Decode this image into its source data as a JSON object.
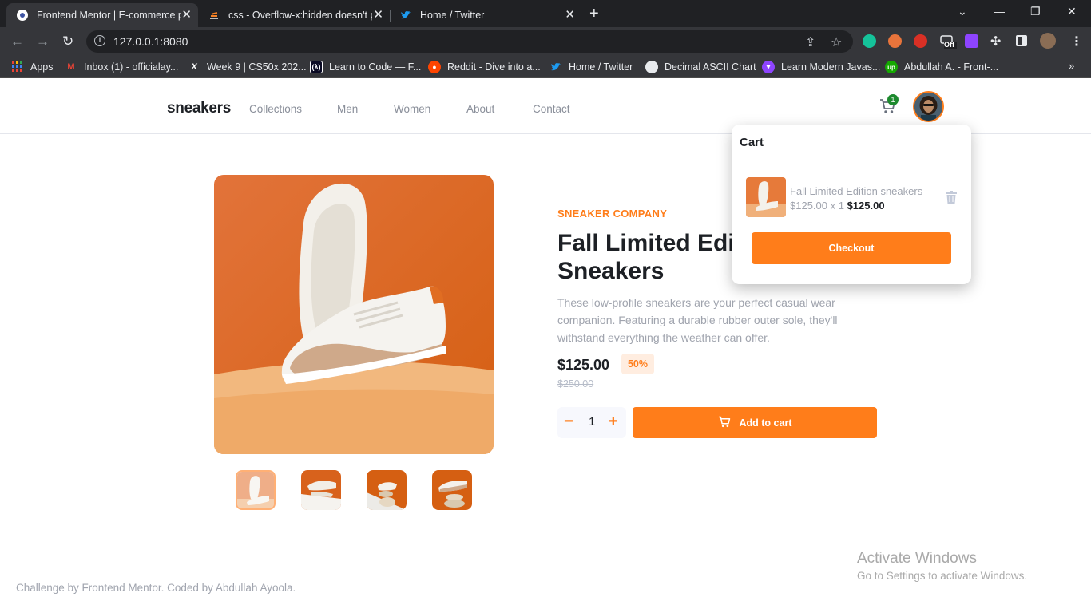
{
  "browser": {
    "tabs": [
      {
        "title": "Frontend Mentor | E-commerce p",
        "active": true
      },
      {
        "title": "css - Overflow-x:hidden doesn't p",
        "active": false
      },
      {
        "title": "Home / Twitter",
        "active": false
      }
    ],
    "url": "127.0.0.1:8080",
    "bookmarks": [
      "Apps",
      "Inbox (1) - officialay...",
      "Week 9 | CS50x 202...",
      "Learn to Code — F...",
      "Reddit - Dive into a...",
      "Home / Twitter",
      "Decimal ASCII Chart",
      "Learn Modern Javas...",
      "Abdullah A. - Front-..."
    ],
    "extension_badge": "Off"
  },
  "nav": {
    "logo": "sneakers",
    "links": [
      "Collections",
      "Men",
      "Women",
      "About",
      "Contact"
    ],
    "cart_count": "1"
  },
  "product": {
    "company": "SNEAKER COMPANY",
    "title": "Fall Limited Edition Sneakers",
    "description": "These low-profile sneakers are your perfect casual wear companion. Featuring a durable rubber outer sole, they'll withstand everything the weather can offer.",
    "price": "$125.00",
    "discount": "50%",
    "old_price": "$250.00",
    "quantity": "1",
    "minus": "−",
    "plus": "+",
    "add_to_cart": "Add to cart"
  },
  "cart": {
    "title": "Cart",
    "item_name": "Fall Limited Edition sneakers",
    "item_price": "$125.00 x 1",
    "item_total": "$125.00",
    "checkout": "Checkout"
  },
  "footer": "Challenge by Frontend Mentor. Coded by Abdullah Ayoola.",
  "watermark": {
    "line1": "Activate Windows",
    "line2": "Go to Settings to activate Windows."
  },
  "colors": {
    "accent": "#ff7d1a",
    "accent_pale": "#ffede0",
    "text_dark": "#1d2025",
    "text_gray": "#a0a4ae"
  }
}
